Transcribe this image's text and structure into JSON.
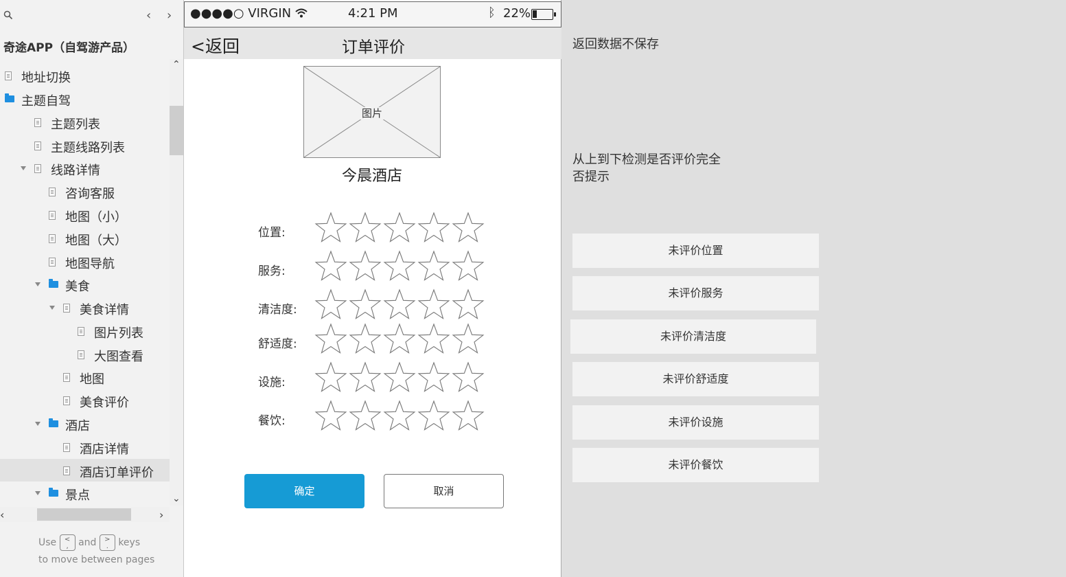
{
  "sidebar": {
    "project_title": "奇途APP（自驾游产品）",
    "items": [
      {
        "label": "地址切换",
        "type": "page",
        "indent": 0,
        "expanded": false
      },
      {
        "label": "主题自驾",
        "type": "folder",
        "indent": 0,
        "expanded": false
      },
      {
        "label": "主题列表",
        "type": "page",
        "indent": 1,
        "expanded": false
      },
      {
        "label": "主题线路列表",
        "type": "page",
        "indent": 1,
        "expanded": false
      },
      {
        "label": "线路详情",
        "type": "page",
        "indent": 1,
        "expanded": true
      },
      {
        "label": "咨询客服",
        "type": "page",
        "indent": 2,
        "expanded": false
      },
      {
        "label": "地图（小）",
        "type": "page",
        "indent": 2,
        "expanded": false
      },
      {
        "label": "地图（大）",
        "type": "page",
        "indent": 2,
        "expanded": false
      },
      {
        "label": "地图导航",
        "type": "page",
        "indent": 2,
        "expanded": false
      },
      {
        "label": "美食",
        "type": "folder",
        "indent": 2,
        "expanded": true
      },
      {
        "label": "美食详情",
        "type": "page",
        "indent": 3,
        "expanded": true
      },
      {
        "label": "图片列表",
        "type": "page",
        "indent": 4,
        "expanded": false
      },
      {
        "label": "大图查看",
        "type": "page",
        "indent": 4,
        "expanded": false
      },
      {
        "label": "地图",
        "type": "page",
        "indent": 3,
        "expanded": false
      },
      {
        "label": "美食评价",
        "type": "page",
        "indent": 3,
        "expanded": false
      },
      {
        "label": "酒店",
        "type": "folder",
        "indent": 2,
        "expanded": true
      },
      {
        "label": "酒店详情",
        "type": "page",
        "indent": 3,
        "expanded": false
      },
      {
        "label": "酒店订单评价",
        "type": "page",
        "indent": 3,
        "expanded": false,
        "selected": true
      },
      {
        "label": "景点",
        "type": "folder",
        "indent": 2,
        "expanded": true
      }
    ],
    "hint": {
      "use": "Use",
      "and": "and",
      "keys": "keys",
      "line2": "to move between pages",
      "key_prev": "<",
      "key_next": ">"
    }
  },
  "phone": {
    "status": {
      "carrier": "●●●●○ VIRGIN",
      "time": "4:21 PM",
      "battery": "22%",
      "battery_level": 0.22
    },
    "nav": {
      "back": "<返回",
      "title": "订单评价"
    },
    "image_caption": "图片",
    "hotel_name": "今晨酒店",
    "ratings": [
      {
        "label": "位置:",
        "stars": 5,
        "filled": 0
      },
      {
        "label": "服务:",
        "stars": 5,
        "filled": 0
      },
      {
        "label": "清洁度:",
        "stars": 5,
        "filled": 0
      },
      {
        "label": "舒适度:",
        "stars": 5,
        "filled": 0
      },
      {
        "label": "设施:",
        "stars": 5,
        "filled": 0
      },
      {
        "label": "餐饮:",
        "stars": 5,
        "filled": 0
      }
    ],
    "confirm": "确定",
    "cancel": "取消"
  },
  "notes": {
    "back_note": "返回数据不保存",
    "check_note_line1": "从上到下检测是否评价完全",
    "check_note_line2": "否提示",
    "tips": [
      "未评价位置",
      "未评价服务",
      "未评价清洁度",
      "未评价舒适度",
      "未评价设施",
      "未评价餐饮"
    ]
  },
  "colors": {
    "accent": "#169bd5",
    "folder": "#1e8fe0",
    "canvas": "#dfdfdf"
  }
}
